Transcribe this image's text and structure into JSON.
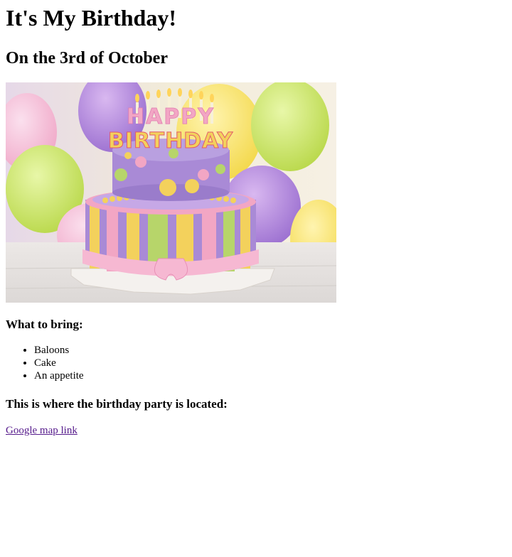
{
  "title": "It's My Birthday!",
  "subtitle": "On the 3rd of October",
  "image": {
    "icon": "birthday-cake-photo",
    "cake_text_top": "HAPPY",
    "cake_text_bottom": "BIRTHDAY",
    "colors": {
      "lavender": "#a98ad6",
      "yellow": "#f3d15c",
      "green": "#b7d56a",
      "pink": "#f2a6c4",
      "board": "#f4f1ee"
    }
  },
  "bring": {
    "heading": "What to bring:",
    "items": [
      "Baloons",
      "Cake",
      "An appetite"
    ]
  },
  "location": {
    "heading": "This is where the birthday party is located:",
    "link_text": "Google map link"
  }
}
